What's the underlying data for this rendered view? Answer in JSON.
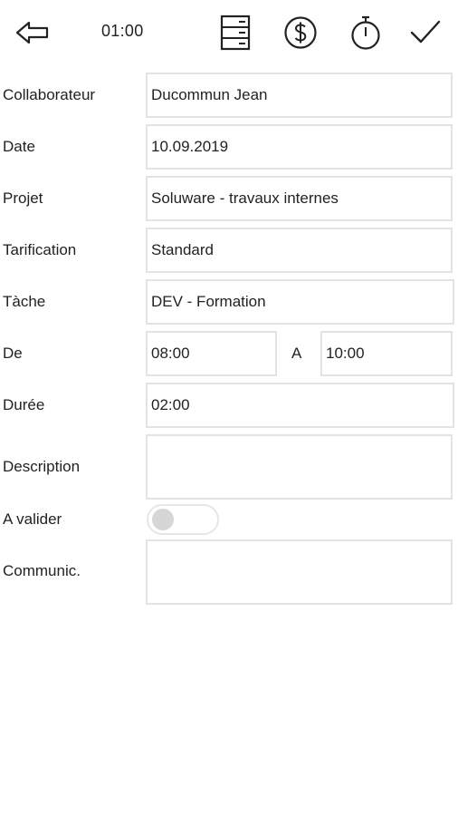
{
  "toolbar": {
    "back_icon": "back-arrow-icon",
    "time": "01:00",
    "list_icon": "list-icon",
    "price_icon": "dollar-icon",
    "timer_icon": "stopwatch-icon",
    "confirm_icon": "checkmark-icon"
  },
  "form": {
    "collaborateur": {
      "label": "Collaborateur",
      "value": "Ducommun Jean"
    },
    "date": {
      "label": "Date",
      "value": "10.09.2019"
    },
    "projet": {
      "label": "Projet",
      "value": "Soluware - travaux internes"
    },
    "tarification": {
      "label": "Tarification",
      "value": "Standard"
    },
    "tache": {
      "label": "Tàche",
      "value": "DEV - Formation"
    },
    "de": {
      "label": "De",
      "value": "08:00"
    },
    "a": {
      "label": "A",
      "value": "10:00"
    },
    "duree": {
      "label": "Durée",
      "value": "02:00"
    },
    "description": {
      "label": "Description",
      "value": ""
    },
    "a_valider": {
      "label": "A valider",
      "checked": false
    },
    "communic": {
      "label": "Communic.",
      "value": ""
    }
  }
}
